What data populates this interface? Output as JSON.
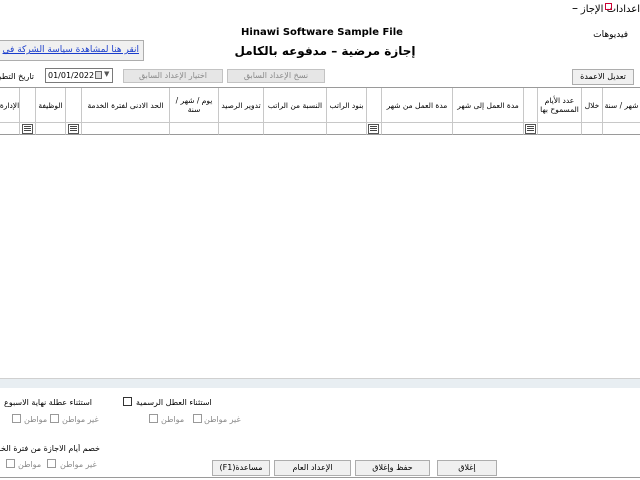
{
  "window": {
    "title": "اعدادات الإجازات"
  },
  "header": {
    "videos_link": "فيديوهات",
    "sample_title": "Hinawi Software Sample File",
    "page_title": "إجازة مرضية – مدفوعه بالكامل",
    "policy_link": "انقر هنا لمشاهدة سياسة الشركة في"
  },
  "toolbar": {
    "date_label": "تاريخ التطبيق",
    "date_value": "01/01/2022",
    "choose_prev_label": "اختيار الإعداد السابق",
    "copy_prev_label": "نسخ الإعداد السابق",
    "edit_column_label": "تعديل الاعمدة"
  },
  "grid": {
    "columns": [
      "الإدارة",
      "الوظيفة",
      "الحد الادنى لفترة الخدمة",
      "يوم / شهر / سنة",
      "تدوير الرصيد",
      "النسبة من الراتب",
      "بنود الراتب",
      "مدة العمل من شهر",
      "مدة العمل إلى شهر",
      "عدد الأيام المسموح بها",
      "خلال",
      "شهر / سنة"
    ]
  },
  "options": {
    "exclude_weekend": "استثناء عطلة نهاية الاسبوع",
    "exclude_holidays": "استثناء العطل الرسمية",
    "deduct_leave_days": "خصم أيام الاجازة من فترة الخدمة",
    "citizen": "مواطن",
    "non_citizen": "غير مواطن"
  },
  "footer": {
    "close_label": "إغلاق",
    "save_close_label": "حفظ وإغلاق",
    "general_settings_label": "الإعداد العام",
    "help_label": "(F1)مساعدة"
  }
}
